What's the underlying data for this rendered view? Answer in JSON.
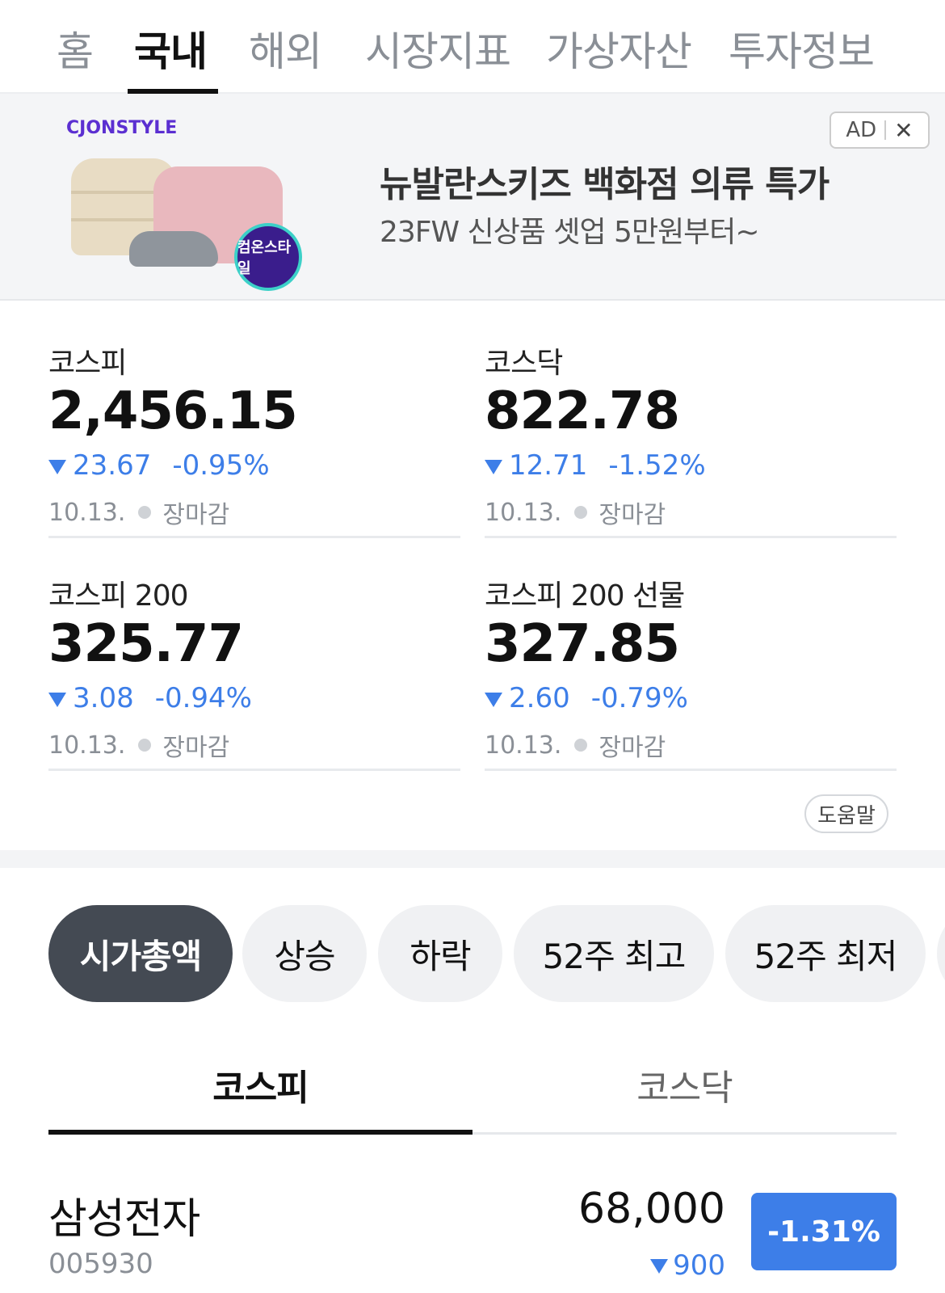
{
  "nav": {
    "tabs": [
      "홈",
      "국내",
      "해외",
      "시장지표",
      "가상자산",
      "투자정보"
    ],
    "active_index": 1
  },
  "ad": {
    "brand": "CJONSTYLE",
    "badge": "컴온스타일",
    "title": "뉴발란스키즈 백화점 의류 특가",
    "subtitle": "23FW 신상품 셋업 5만원부터~",
    "ad_label": "AD",
    "close_label": "✕"
  },
  "indices": [
    {
      "name": "코스피",
      "value": "2,456.15",
      "change": "23.67",
      "percent": "-0.95%",
      "date": "10.13.",
      "status": "장마감",
      "direction": "down"
    },
    {
      "name": "코스닥",
      "value": "822.78",
      "change": "12.71",
      "percent": "-1.52%",
      "date": "10.13.",
      "status": "장마감",
      "direction": "down"
    },
    {
      "name": "코스피 200",
      "value": "325.77",
      "change": "3.08",
      "percent": "-0.94%",
      "date": "10.13.",
      "status": "장마감",
      "direction": "down"
    },
    {
      "name": "코스피 200 선물",
      "value": "327.85",
      "change": "2.60",
      "percent": "-0.79%",
      "date": "10.13.",
      "status": "장마감",
      "direction": "down"
    }
  ],
  "help_label": "도움말",
  "filters": {
    "chips": [
      "시가총액",
      "상승",
      "하락",
      "52주 최고",
      "52주 최저"
    ],
    "active_index": 0
  },
  "market_tabs": {
    "tabs": [
      "코스피",
      "코스닥"
    ],
    "active_index": 0
  },
  "stocks": [
    {
      "name": "삼성전자",
      "code": "005930",
      "price": "68,000",
      "change": "900",
      "rate": "-1.31%",
      "direction": "down"
    }
  ],
  "colors": {
    "down": "#3d7ee8",
    "active_chip": "#444a53",
    "brand": "#5b2fd1"
  }
}
